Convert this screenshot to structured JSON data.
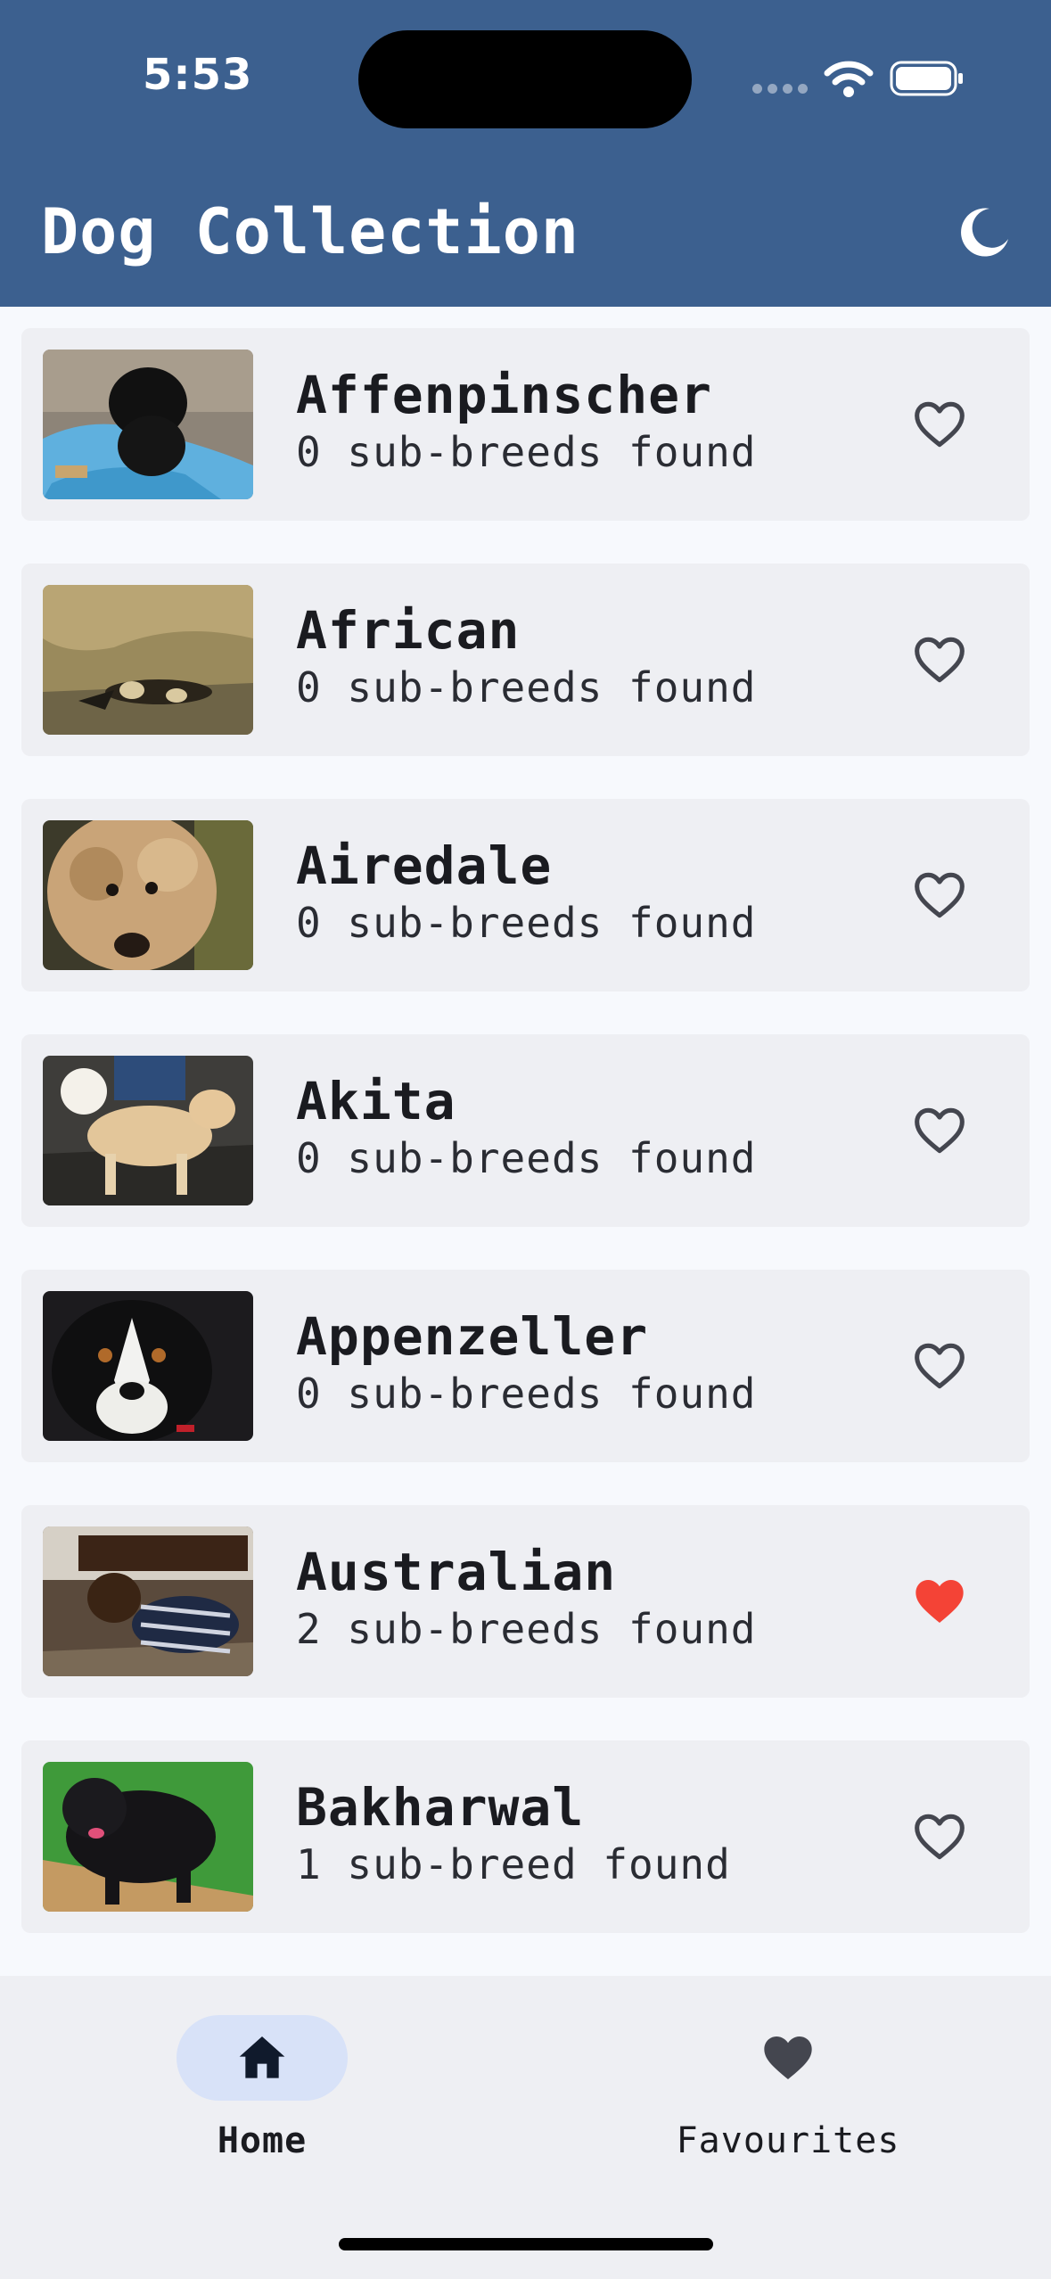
{
  "status_bar": {
    "time": "5:53"
  },
  "header": {
    "title": "Dog Collection",
    "theme_icon": "moon-icon"
  },
  "breeds": [
    {
      "name": "Affenpinscher",
      "sub_breeds": "0 sub-breeds found",
      "favourite": false
    },
    {
      "name": "African",
      "sub_breeds": "0 sub-breeds found",
      "favourite": false
    },
    {
      "name": "Airedale",
      "sub_breeds": "0 sub-breeds found",
      "favourite": false
    },
    {
      "name": "Akita",
      "sub_breeds": "0 sub-breeds found",
      "favourite": false
    },
    {
      "name": "Appenzeller",
      "sub_breeds": "0 sub-breeds found",
      "favourite": false
    },
    {
      "name": "Australian",
      "sub_breeds": "2 sub-breeds found",
      "favourite": true
    },
    {
      "name": "Bakharwal",
      "sub_breeds": "1 sub-breed found",
      "favourite": false
    }
  ],
  "nav": {
    "home_label": "Home",
    "favourites_label": "Favourites",
    "active": "Home"
  },
  "colors": {
    "header": "#3c608f",
    "card": "#eeeff3",
    "favourite_active": "#f44336",
    "favourite_inactive": "#44464f",
    "nav_active_pill": "#d8e2f8"
  }
}
